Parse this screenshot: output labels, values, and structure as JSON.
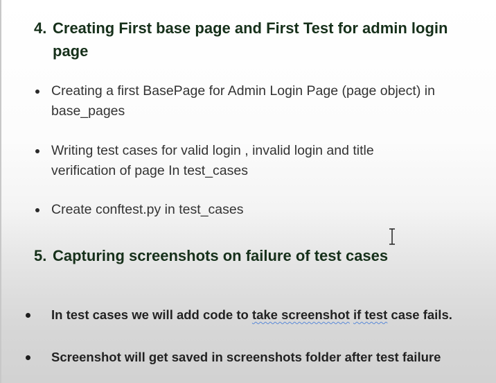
{
  "section4": {
    "number": "4.",
    "title": "Creating First base page and First Test for admin login page",
    "bullets": [
      "Creating a first BasePage for Admin Login Page (page object) in base_pages",
      "Writing test cases for valid login , invalid login and title verification of page In test_cases",
      "Create conftest.py in test_cases"
    ]
  },
  "section5": {
    "number": "5.",
    "title": "Capturing screenshots on failure of test cases",
    "bullet1": {
      "part1": "In test cases we will add code to ",
      "part2": "take screenshot",
      "part3": " ",
      "part4": "if test",
      "part5": " case fails."
    },
    "bullet2": "Screenshot will get saved in screenshots folder after test failure"
  },
  "colors": {
    "heading": "#16301a",
    "body_text": "#333333",
    "spellcheck_underline": "#5a8ad8"
  },
  "icons": [
    "text-cursor-icon",
    "bullet-dot-icon"
  ]
}
